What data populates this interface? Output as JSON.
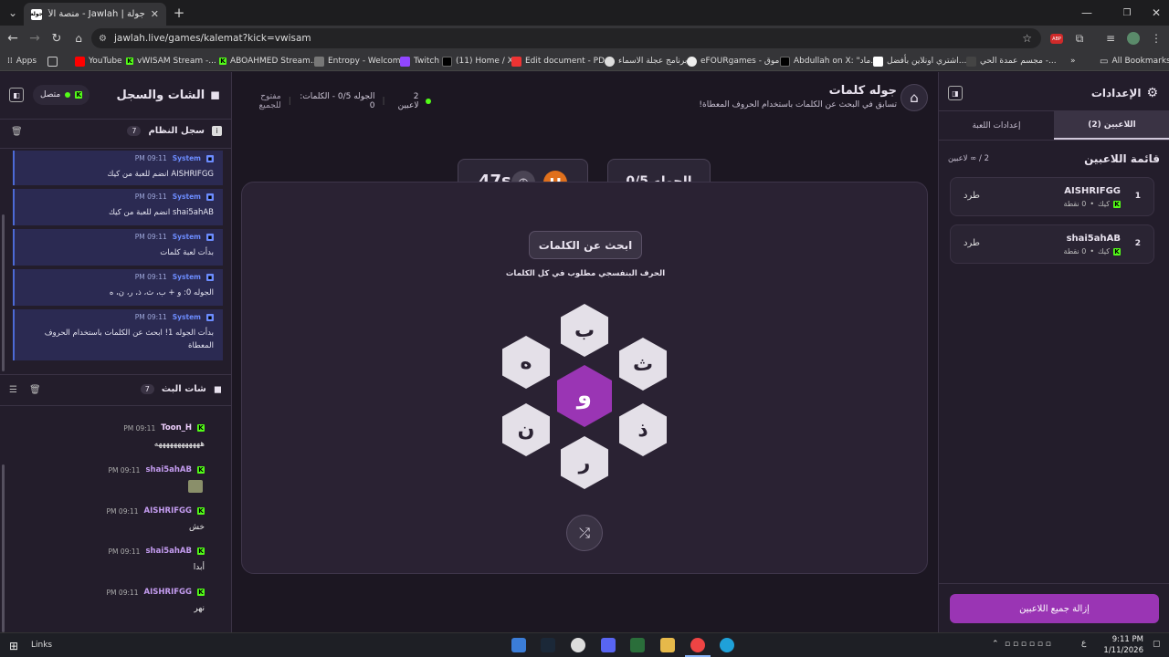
{
  "browser": {
    "tab_title": "جولة | Jawlah - منصة الألعاب ال...",
    "tab_favicon_text": "جولة",
    "url": "jawlah.live/games/kalemat?kick=vwisam",
    "bookmarks": [
      "Apps",
      "YouTube",
      "vWISAM Stream -...",
      "ABOAHMED Stream...",
      "Entropy - Welcome",
      "Twitch",
      "(11) Home / X",
      "Edit document - PD...",
      "برنامج عجلة الاسماء",
      "eFOURgames - موق...",
      "Abdullah on X: \"ماد...",
      "اشتري اونلاين بأفضل...",
      "مجسم عمدة الحي -...",
      "All Bookmarks"
    ]
  },
  "left": {
    "title": "الشات والسجل",
    "connected": "متصل",
    "system_log": {
      "title": "سجل النظام",
      "count": "7",
      "messages": [
        {
          "author": "System",
          "time": "09:11 PM",
          "text": "AISHRIFGG انضم للعبة من كيك"
        },
        {
          "author": "System",
          "time": "09:11 PM",
          "text": "shai5ahAB انضم للعبة من كيك"
        },
        {
          "author": "System",
          "time": "09:11 PM",
          "text": "بدأت لعبة كلمات"
        },
        {
          "author": "System",
          "time": "09:11 PM",
          "text": "الجوله 0: و + ب، ث، ذ، ر، ن، ه"
        },
        {
          "author": "System",
          "time": "09:11 PM",
          "text": "بدأت الجوله 1! ابحث عن الكلمات باستخدام الحروف المعطاة"
        }
      ]
    },
    "stream_chat": {
      "title": "شات البث",
      "count": "7",
      "messages": [
        {
          "author": "Toon_H",
          "time": "09:11 PM",
          "text": "ههههههههههههه",
          "color": "#f0c8ff"
        },
        {
          "author": "shai5ahAB",
          "time": "09:11 PM",
          "text": "",
          "color": "#c49cf0"
        },
        {
          "author": "AISHRIFGG",
          "time": "09:11 PM",
          "text": "خش",
          "color": "#c49cf0"
        },
        {
          "author": "shai5ahAB",
          "time": "09:11 PM",
          "text": "أبدا",
          "color": "#c49cf0"
        },
        {
          "author": "AISHRIFGG",
          "time": "09:11 PM",
          "text": "نهر",
          "color": "#c49cf0"
        }
      ]
    }
  },
  "header": {
    "title": "جوله كلمات",
    "subtitle": "تسابق في البحث عن الكلمات باستخدام الحروف المعطاة!",
    "players": "2 لاعبين",
    "round_info": "الجوله 0/5 - الكلمات: 0",
    "open": "مفتوح للجميع"
  },
  "game": {
    "round": "الجوله 0/5",
    "timer": "47s",
    "prompt": "ابحث عن الكلمات",
    "hint": "الحرف البنفسجي مطلوب في كل الكلمات",
    "center_letter": "و",
    "letters": [
      "ب",
      "ث",
      "ذ",
      "ر",
      "ن",
      "ه"
    ]
  },
  "right": {
    "title": "الإعدادات",
    "tab_players": "اللاعبين (2)",
    "tab_settings": "إعدادات اللعبة",
    "list_title": "قائمة اللاعبين",
    "list_count": "2 / ∞ لاعبين",
    "players": [
      {
        "rank": "1",
        "name": "AISHRIFGG",
        "platform": "كيك",
        "points": "0 نقطة",
        "kick_label": "طرد"
      },
      {
        "rank": "2",
        "name": "shai5ahAB",
        "platform": "كيك",
        "points": "0 نقطة",
        "kick_label": "طرد"
      }
    ],
    "remove_all": "إزالة جميع اللاعبين"
  },
  "taskbar": {
    "links": "Links",
    "time": "9:11 PM",
    "date": "1/11/2026",
    "lang": "ع"
  },
  "colors": {
    "accent": "#9a35b4",
    "timer_btn": "#e0701c",
    "kick_green": "#53fc18",
    "system_blue": "#4c6ad6"
  }
}
